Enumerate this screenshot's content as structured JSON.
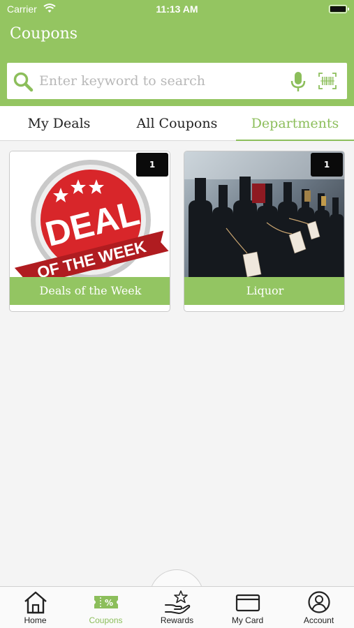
{
  "status_bar": {
    "carrier": "Carrier",
    "time": "11:13 AM"
  },
  "header": {
    "title": "Coupons"
  },
  "search": {
    "placeholder": "Enter keyword to search"
  },
  "tabs": [
    {
      "label": "My Deals",
      "active": false
    },
    {
      "label": "All Coupons",
      "active": false
    },
    {
      "label": "Departments",
      "active": true
    }
  ],
  "departments": [
    {
      "name": "Deals of the Week",
      "count": "1",
      "image_text": [
        "DEAL",
        "OF THE WEEK"
      ]
    },
    {
      "name": "Liquor",
      "count": "1"
    }
  ],
  "bottom_nav": [
    {
      "label": "Home",
      "icon": "home-icon",
      "active": false
    },
    {
      "label": "Coupons",
      "icon": "coupon-icon",
      "active": true
    },
    {
      "label": "Rewards",
      "icon": "rewards-hand-star-icon",
      "active": false
    },
    {
      "label": "My Card",
      "icon": "card-icon",
      "active": false
    },
    {
      "label": "Account",
      "icon": "account-icon",
      "active": false
    }
  ],
  "colors": {
    "brand_green": "#94c561",
    "active_tab_green": "#8cbe5b",
    "badge_black": "#0a0a0a",
    "deal_red": "#d8262a"
  }
}
